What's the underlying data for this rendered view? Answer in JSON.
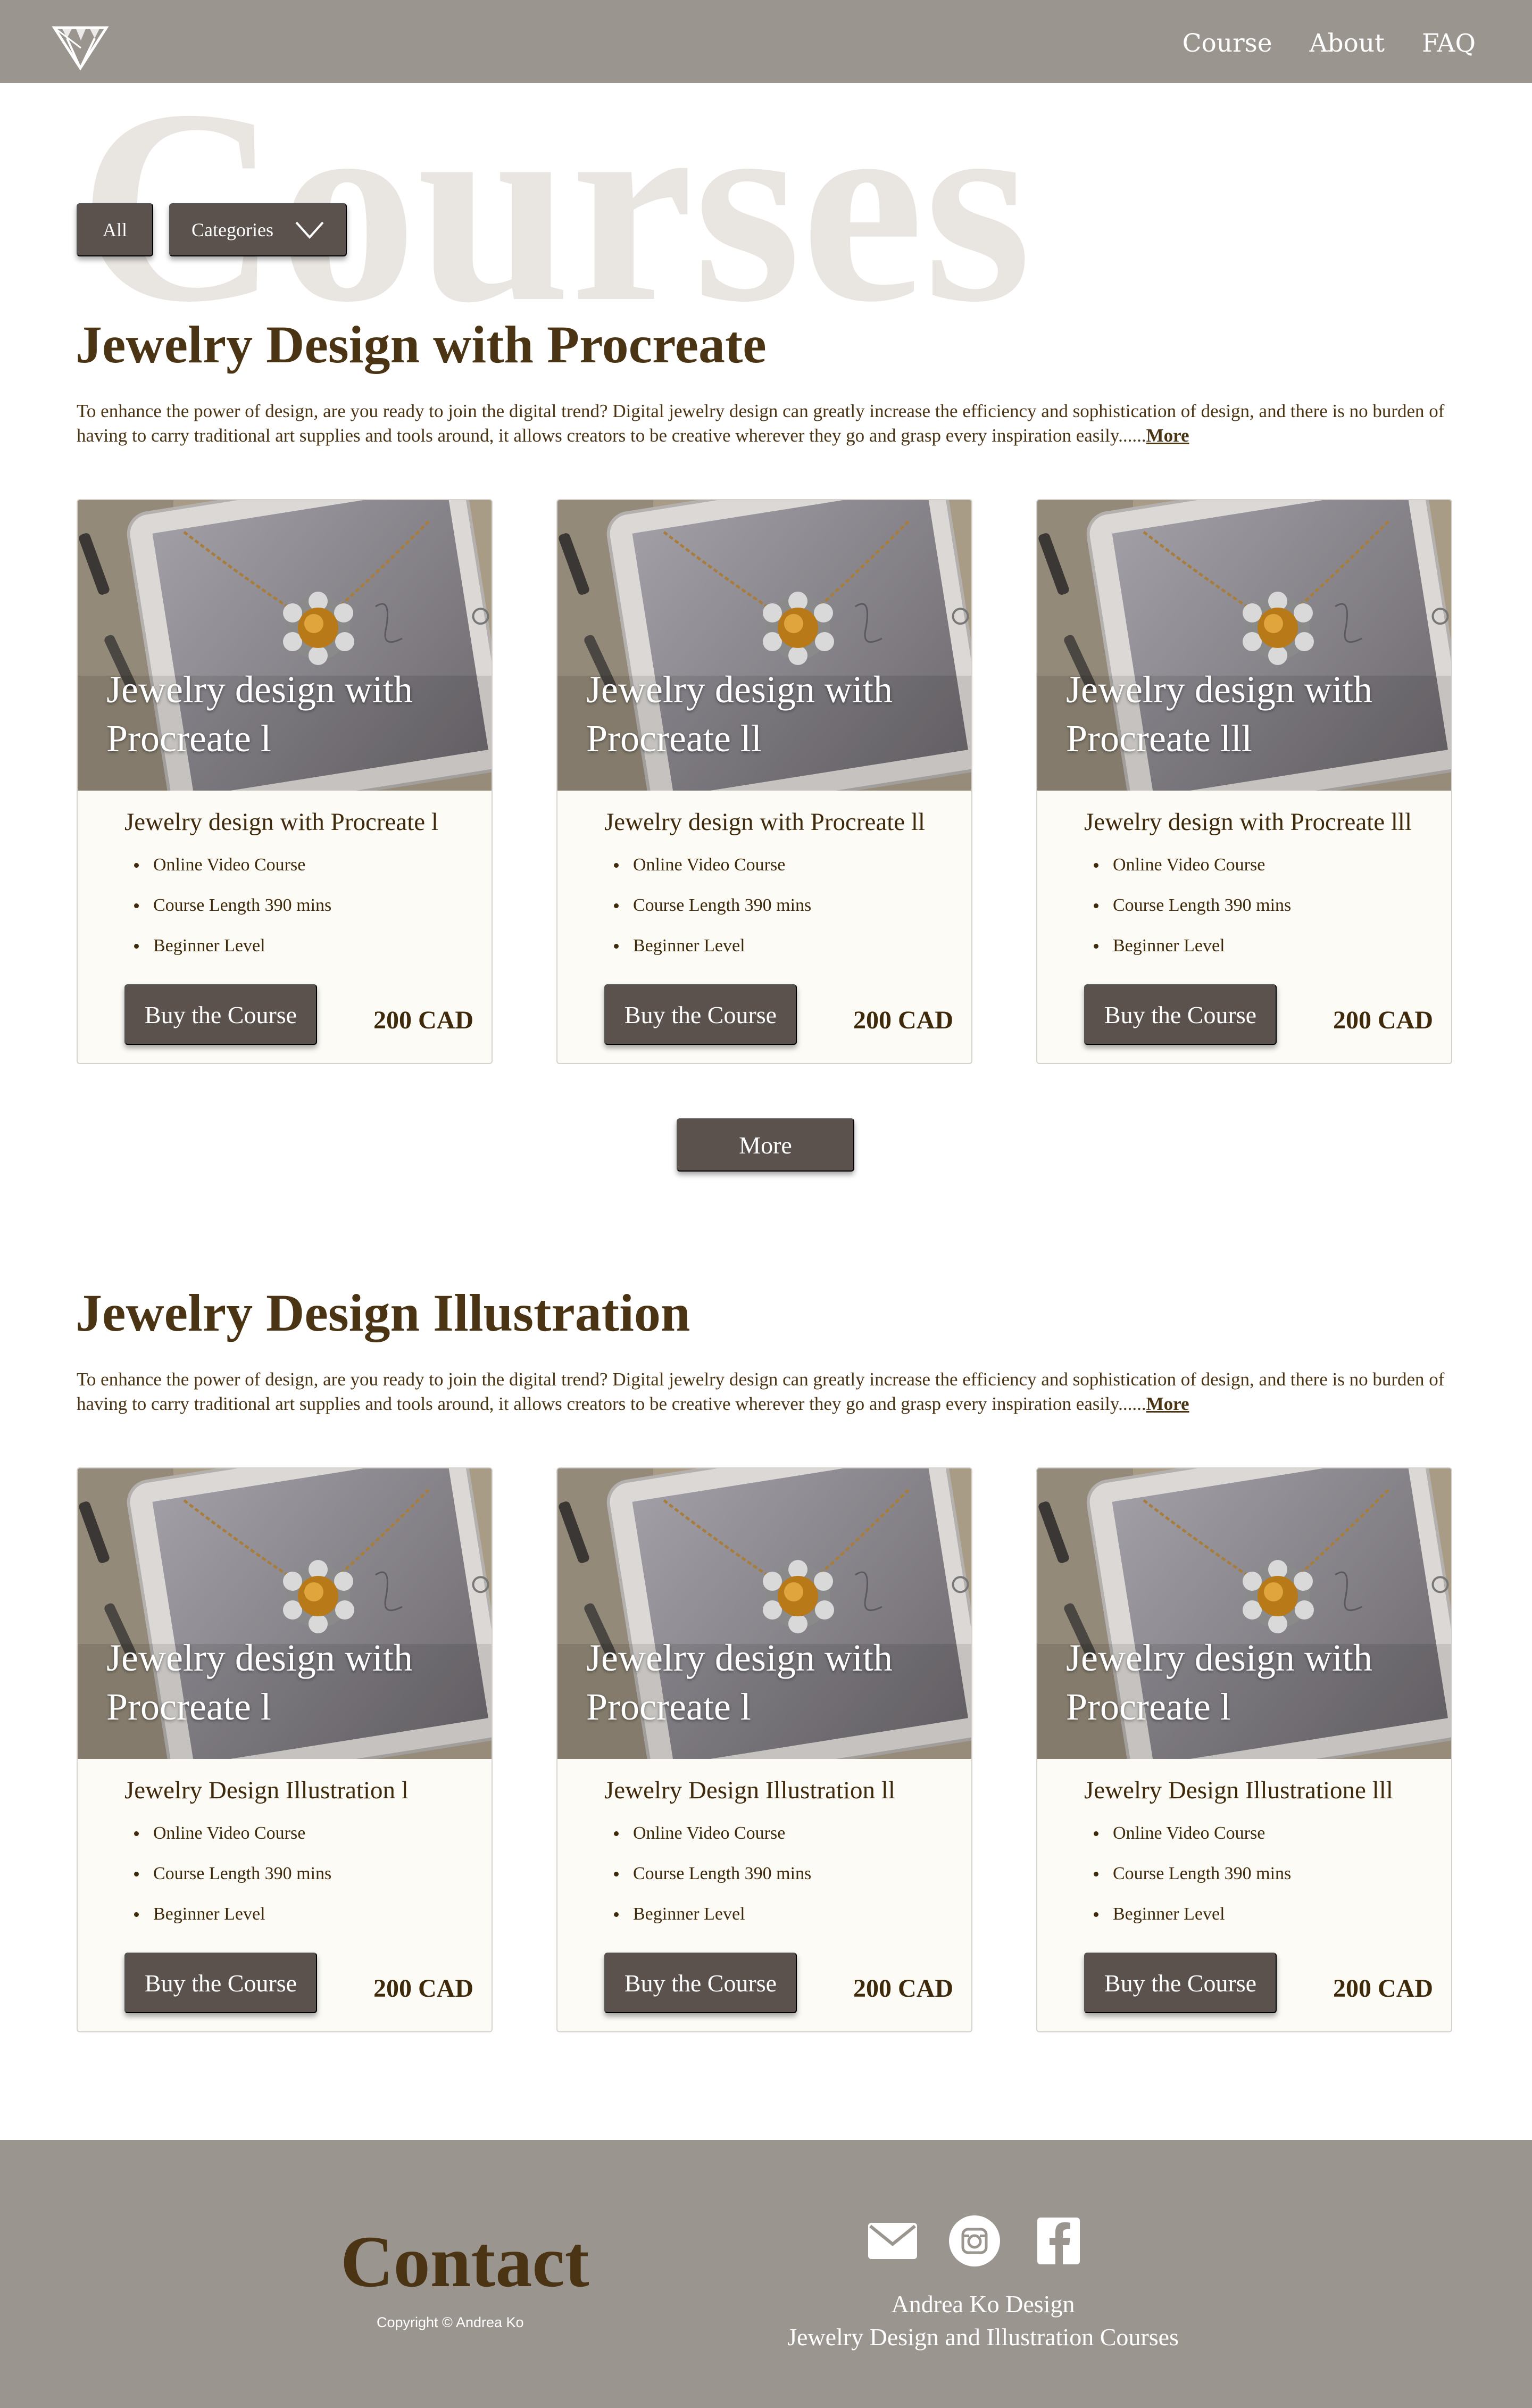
{
  "nav": {
    "links": [
      "Course",
      "About",
      "FAQ"
    ]
  },
  "watermark": "Courses",
  "filters": {
    "all_label": "All",
    "categories_label": "Categories"
  },
  "sections": [
    {
      "title": "Jewelry Design with Procreate",
      "description": "To enhance the power of design, are you ready to join the digital trend? Digital jewelry design can greatly increase the efficiency and sophistication of design, and there is no burden of having to carry traditional art supplies and tools around, it allows creators to be creative wherever they go and grasp every inspiration easily......",
      "more_label": "More",
      "cards": [
        {
          "image_title": "Jewelry design with Procreate l",
          "name": "Jewelry design with Procreate l",
          "features": [
            "Online Video Course",
            "Course Length 390 mins",
            "Beginner Level"
          ],
          "button": "Buy the Course",
          "price": "200 CAD"
        },
        {
          "image_title": "Jewelry design with Procreate ll",
          "name": "Jewelry design with Procreate ll",
          "features": [
            "Online Video Course",
            "Course Length 390 mins",
            "Beginner Level"
          ],
          "button": "Buy the Course",
          "price": "200 CAD"
        },
        {
          "image_title": "Jewelry design with Procreate lll",
          "name": "Jewelry design with Procreate lll",
          "features": [
            "Online Video Course",
            "Course Length 390 mins",
            "Beginner Level"
          ],
          "button": "Buy the Course",
          "price": "200 CAD"
        }
      ]
    },
    {
      "title": "Jewelry Design Illustration",
      "description": "To enhance the power of design, are you ready to join the digital trend? Digital jewelry design can greatly increase the efficiency and sophistication of design, and there is no burden of having to carry traditional art supplies and tools around, it allows creators to be creative wherever they go and grasp every inspiration easily......",
      "more_label": "More",
      "cards": [
        {
          "image_title": "Jewelry design with Procreate l",
          "name": "Jewelry Design Illustration l",
          "features": [
            "Online Video Course",
            "Course Length 390 mins",
            "Beginner Level"
          ],
          "button": "Buy the Course",
          "price": "200 CAD"
        },
        {
          "image_title": "Jewelry design with Procreate l",
          "name": "Jewelry Design Illustration ll",
          "features": [
            "Online Video Course",
            "Course Length 390 mins",
            "Beginner Level"
          ],
          "button": "Buy the Course",
          "price": "200 CAD"
        },
        {
          "image_title": "Jewelry design with Procreate l",
          "name": "Jewelry Design Illustratione lll",
          "features": [
            "Online Video Course",
            "Course Length 390 mins",
            "Beginner Level"
          ],
          "button": "Buy the Course",
          "price": "200 CAD"
        }
      ]
    }
  ],
  "more_button": "More",
  "footer": {
    "contact_title": "Contact",
    "copyright": "Copyright © Andrea Ko",
    "brand_name": "Andrea Ko Design",
    "brand_tagline": "Jewelry Design and Illustration Courses",
    "icons": [
      "mail-icon",
      "instagram-icon",
      "facebook-icon"
    ]
  },
  "colors": {
    "header_footer_bg": "#9b9590",
    "button_bg": "#5b524e",
    "text_brown": "#4a3413",
    "card_bg": "#fdfbf6",
    "watermark": "#e9e5e1"
  }
}
